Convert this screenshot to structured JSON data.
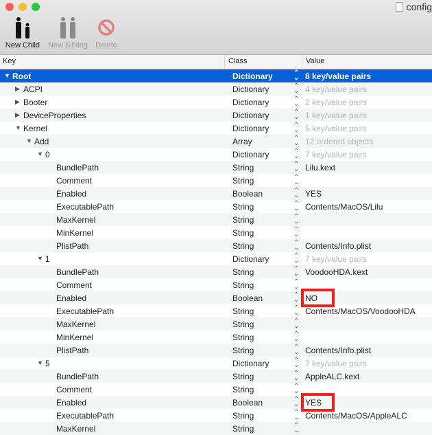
{
  "window": {
    "title": "config"
  },
  "toolbar": {
    "new_child": "New Child",
    "new_sibling": "New Sibling",
    "delete": "Delete"
  },
  "columns": {
    "key": "Key",
    "class": "Class",
    "value": "Value"
  },
  "rows": [
    {
      "key": "Root",
      "level": 0,
      "exp": "open",
      "cls": "Dictionary",
      "value": "8 key/value pairs",
      "dim": false,
      "sel": true
    },
    {
      "key": "ACPI",
      "level": 1,
      "exp": "closed",
      "cls": "Dictionary",
      "value": "4 key/value pairs",
      "dim": true
    },
    {
      "key": "Booter",
      "level": 1,
      "exp": "closed",
      "cls": "Dictionary",
      "value": "2 key/value pairs",
      "dim": true
    },
    {
      "key": "DeviceProperties",
      "level": 1,
      "exp": "closed",
      "cls": "Dictionary",
      "value": "1 key/value pairs",
      "dim": true
    },
    {
      "key": "Kernel",
      "level": 1,
      "exp": "open",
      "cls": "Dictionary",
      "value": "5 key/value pairs",
      "dim": true
    },
    {
      "key": "Add",
      "level": 2,
      "exp": "open",
      "cls": "Array",
      "value": "12 ordered objects",
      "dim": true
    },
    {
      "key": "0",
      "level": 3,
      "exp": "open",
      "cls": "Dictionary",
      "value": "7 key/value pairs",
      "dim": true
    },
    {
      "key": "BundlePath",
      "level": 4,
      "cls": "String",
      "value": "Lilu.kext"
    },
    {
      "key": "Comment",
      "level": 4,
      "cls": "String",
      "value": ""
    },
    {
      "key": "Enabled",
      "level": 4,
      "cls": "Boolean",
      "value": " YES"
    },
    {
      "key": "ExecutablePath",
      "level": 4,
      "cls": "String",
      "value": "Contents/MacOS/Lilu"
    },
    {
      "key": "MaxKernel",
      "level": 4,
      "cls": "String",
      "value": ""
    },
    {
      "key": "MinKernel",
      "level": 4,
      "cls": "String",
      "value": ""
    },
    {
      "key": "PlistPath",
      "level": 4,
      "cls": "String",
      "value": "Contents/Info.plist"
    },
    {
      "key": "1",
      "level": 3,
      "exp": "open",
      "cls": "Dictionary",
      "value": "7 key/value pairs",
      "dim": true
    },
    {
      "key": "BundlePath",
      "level": 4,
      "cls": "String",
      "value": "VoodooHDA.kext"
    },
    {
      "key": "Comment",
      "level": 4,
      "cls": "String",
      "value": ""
    },
    {
      "key": "Enabled",
      "level": 4,
      "cls": "Boolean",
      "value": " NO"
    },
    {
      "key": "ExecutablePath",
      "level": 4,
      "cls": "String",
      "value": "Contents/MacOS/VoodooHDA"
    },
    {
      "key": "MaxKernel",
      "level": 4,
      "cls": "String",
      "value": ""
    },
    {
      "key": "MinKernel",
      "level": 4,
      "cls": "String",
      "value": ""
    },
    {
      "key": "PlistPath",
      "level": 4,
      "cls": "String",
      "value": "Contents/Info.plist"
    },
    {
      "key": "5",
      "level": 3,
      "exp": "open",
      "cls": "Dictionary",
      "value": "7 key/value pairs",
      "dim": true
    },
    {
      "key": "BundlePath",
      "level": 4,
      "cls": "String",
      "value": "AppleALC.kext"
    },
    {
      "key": "Comment",
      "level": 4,
      "cls": "String",
      "value": ""
    },
    {
      "key": "Enabled",
      "level": 4,
      "cls": "Boolean",
      "value": " YES"
    },
    {
      "key": "ExecutablePath",
      "level": 4,
      "cls": "String",
      "value": "Contents/MacOS/AppleALC"
    },
    {
      "key": "MaxKernel",
      "level": 4,
      "cls": "String",
      "value": ""
    }
  ]
}
